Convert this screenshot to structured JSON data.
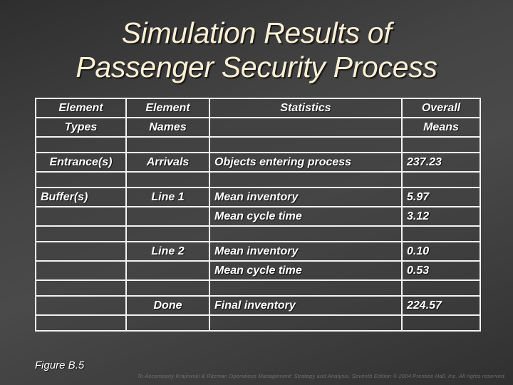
{
  "title": {
    "line1": "Simulation Results of",
    "line2": "Passenger Security Process"
  },
  "table": {
    "header": {
      "row1": [
        "Element",
        "Element",
        "Statistics",
        "Overall"
      ],
      "row2": [
        "Types",
        "Names",
        "",
        "Means"
      ]
    },
    "rows": [
      {
        "type": "",
        "name": "",
        "statistic": "",
        "mean": ""
      },
      {
        "type": "Entrance(s)",
        "name": "Arrivals",
        "statistic": "Objects entering process",
        "mean": "237.23"
      },
      {
        "type": "",
        "name": "",
        "statistic": "",
        "mean": ""
      },
      {
        "type": "Buffer(s)",
        "name": "Line 1",
        "statistic": "Mean inventory",
        "mean": "5.97"
      },
      {
        "type": "",
        "name": "",
        "statistic": "Mean cycle time",
        "mean": "3.12"
      },
      {
        "type": "",
        "name": "",
        "statistic": "",
        "mean": ""
      },
      {
        "type": "",
        "name": "Line 2",
        "statistic": "Mean inventory",
        "mean": "0.10"
      },
      {
        "type": "",
        "name": "",
        "statistic": "Mean cycle time",
        "mean": "0.53"
      },
      {
        "type": "",
        "name": "",
        "statistic": "",
        "mean": ""
      },
      {
        "type": "",
        "name": "Done",
        "statistic": "Final inventory",
        "mean": "224.57"
      },
      {
        "type": "",
        "name": "",
        "statistic": "",
        "mean": ""
      }
    ]
  },
  "figure_label": "Figure B.5",
  "footer": "To Accompany Krajewski & Ritzman Operations Management: Strategy and Analysis, Seventh Edition © 2004 Prentice Hall, Inc. All rights reserved.",
  "colors": {
    "title": "#fcefd4",
    "text": "#ffffff",
    "grid": "#f2f2f2",
    "background": "#444444"
  }
}
